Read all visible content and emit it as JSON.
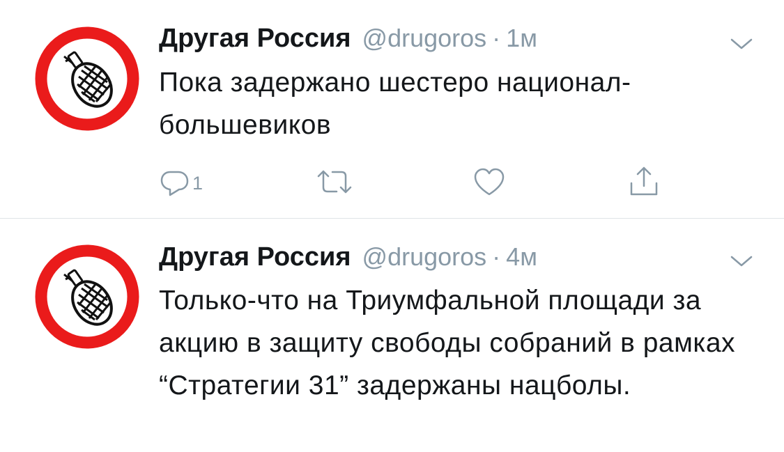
{
  "tweets": [
    {
      "name": "Другая Россия",
      "handle": "@drugoros",
      "separator": "·",
      "time": "1м",
      "text": "Пока задержано шестеро национал-большевиков",
      "reply_count": "1",
      "avatar_icon": "grenade-no-sign-icon",
      "menu_icon": "chevron-down-icon"
    },
    {
      "name": "Другая Россия",
      "handle": "@drugoros",
      "separator": "·",
      "time": "4м",
      "text": "Только-что на Триумфальной площади за акцию в защиту свободы собраний в рамках “Стратегии 31” задержаны нацболы.",
      "avatar_icon": "grenade-no-sign-icon",
      "menu_icon": "chevron-down-icon"
    }
  ],
  "actions": {
    "reply_icon": "reply-icon",
    "retweet_icon": "retweet-icon",
    "like_icon": "heart-icon",
    "share_icon": "share-icon"
  },
  "colors": {
    "avatar_ring": "#ea1b1b",
    "name_text": "#14171a",
    "secondary_text": "#8899a6",
    "divider": "#dfe3e6"
  }
}
